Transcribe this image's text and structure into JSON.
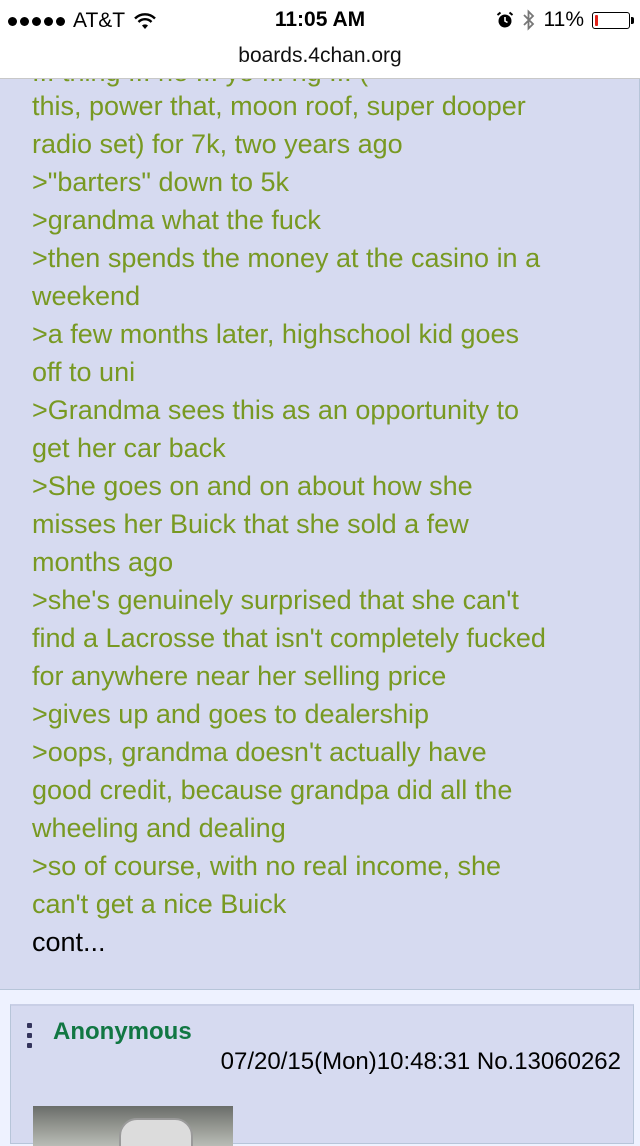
{
  "status_bar": {
    "carrier": "AT&T",
    "time": "11:05 AM",
    "battery_percent": "11%",
    "battery_level": 0.11,
    "icons": [
      "signal-dots-icon",
      "wifi-icon",
      "alarm-icon",
      "bluetooth-icon",
      "battery-icon"
    ]
  },
  "url_bar": {
    "url": "boards.4chan.org"
  },
  "post": {
    "clipped_top_line": "... thing ... he ... yo ... ng ... (",
    "lines": [
      {
        "text": "this, power that, moon roof, super dooper",
        "style": "greentext"
      },
      {
        "text": "radio set) for 7k, two years ago",
        "style": "greentext"
      },
      {
        "text": ">\"barters\" down to 5k",
        "style": "greentext"
      },
      {
        "text": ">grandma what the fuck",
        "style": "greentext"
      },
      {
        "text": ">then spends the money at the casino in a",
        "style": "greentext"
      },
      {
        "text": "weekend",
        "style": "greentext"
      },
      {
        "text": ">a few months later, highschool kid goes",
        "style": "greentext"
      },
      {
        "text": "off to uni",
        "style": "greentext"
      },
      {
        "text": ">Grandma sees this as an opportunity to",
        "style": "greentext"
      },
      {
        "text": "get her car back",
        "style": "greentext"
      },
      {
        "text": ">She goes on and on about how she",
        "style": "greentext"
      },
      {
        "text": "misses her Buick that she sold a few",
        "style": "greentext"
      },
      {
        "text": "months ago",
        "style": "greentext"
      },
      {
        "text": ">she's genuinely surprised that she can't",
        "style": "greentext"
      },
      {
        "text": "find a Lacrosse that isn't completely fucked",
        "style": "greentext"
      },
      {
        "text": "for anywhere near her selling price",
        "style": "greentext"
      },
      {
        "text": ">gives up and goes to dealership",
        "style": "greentext"
      },
      {
        "text": ">oops, grandma doesn't actually have",
        "style": "greentext"
      },
      {
        "text": "good credit, because grandpa did all the",
        "style": "greentext"
      },
      {
        "text": "wheeling and dealing",
        "style": "greentext"
      },
      {
        "text": ">so of course, with no real income, she",
        "style": "greentext"
      },
      {
        "text": "can't get a nice Buick",
        "style": "greentext"
      },
      {
        "text": "cont...",
        "style": "plain"
      }
    ]
  },
  "next_post": {
    "name": "Anonymous",
    "datetime": "07/20/15(Mon)10:48:31",
    "post_number": "No.13060262"
  },
  "colors": {
    "greentext": "#789922",
    "post_background": "#d6daf0",
    "page_background": "#eef2ff",
    "name": "#117743",
    "battery_low": "#e2231a"
  }
}
